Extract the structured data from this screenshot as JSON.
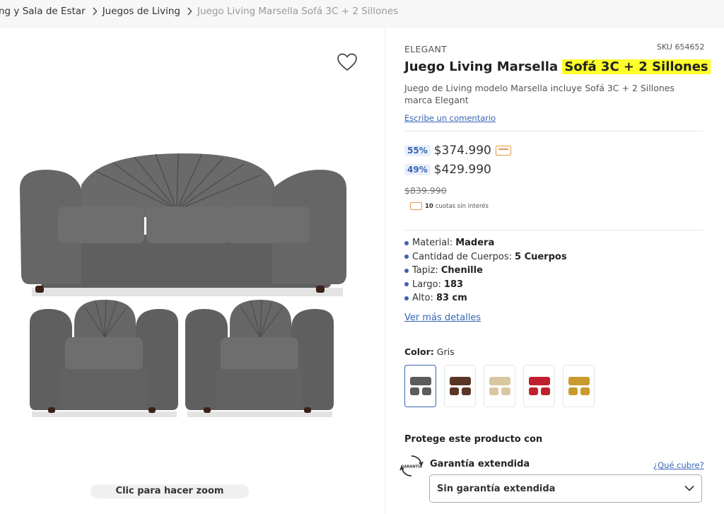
{
  "breadcrumb": {
    "items": [
      "ng y Sala de Estar",
      "Juegos de Living"
    ],
    "current": "Juego Living Marsella Sofá 3C + 2 Sillones"
  },
  "gallery": {
    "zoom_label": "Clic para hacer zoom",
    "wishlist_icon": "heart-icon"
  },
  "product": {
    "brand": "ELEGANT",
    "sku": "SKU 654652",
    "title_plain": "Juego Living Marsella ",
    "title_highlight": "Sofá 3C + 2 Sillones",
    "description": "Juego de Living modelo Marsella incluye Sofá 3C + 2 Sillones marca Elegant",
    "review_link": "Escribe un comentario"
  },
  "pricing": {
    "card_discount": "55%",
    "card_price": "$374.990",
    "internet_discount": "49%",
    "internet_price": "$429.990",
    "normal_price": "$839.990",
    "installments_count": "10",
    "installments_text": "cuotas sin interés"
  },
  "specs": [
    {
      "label": "Material:",
      "value": "Madera"
    },
    {
      "label": "Cantidad de Cuerpos:",
      "value": "5 Cuerpos"
    },
    {
      "label": "Tapiz:",
      "value": "Chenille"
    },
    {
      "label": "Largo:",
      "value": "183"
    },
    {
      "label": "Alto:",
      "value": "83 cm"
    }
  ],
  "more_details_link": "Ver más detalles",
  "color": {
    "label": "Color:",
    "selected": "Gris",
    "swatches": [
      "#5c5c5c",
      "#5a3524",
      "#d9c7a1",
      "#c0202e",
      "#c99a2c"
    ]
  },
  "protection": {
    "title": "Protege este producto con",
    "icon_text": "GARANTÍA",
    "warranty_label": "Garantía extendida",
    "warranty_link": "¿Qué cubre?",
    "select_value": "Sin garantía extendida"
  },
  "colors": {
    "accent": "#3b64b0",
    "highlight": "#ffff2a",
    "sofa": "#5e5e5e"
  }
}
